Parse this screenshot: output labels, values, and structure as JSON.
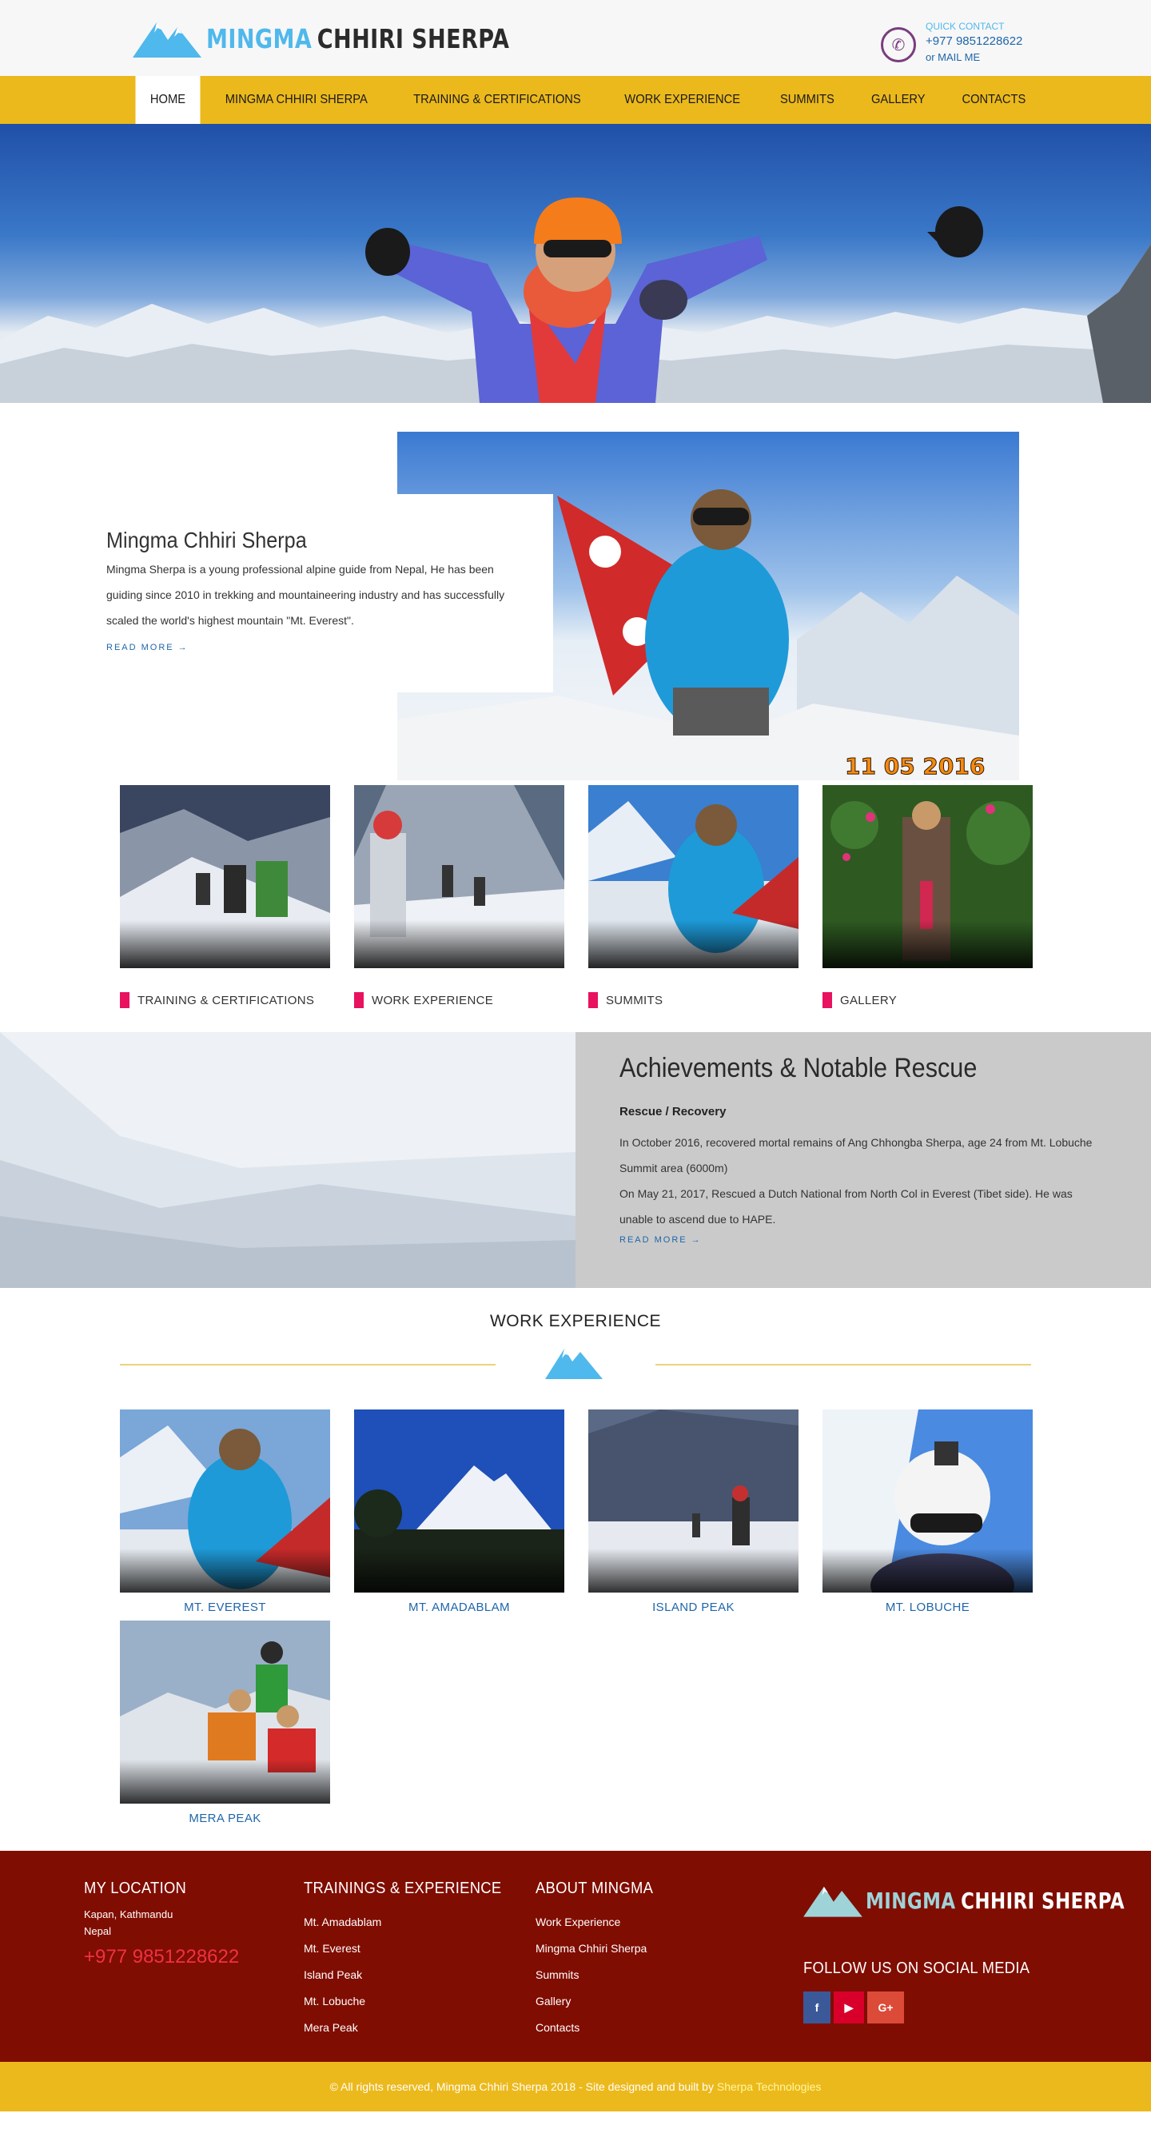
{
  "header": {
    "logo_part1": "MINGMA",
    "logo_part2": "CHHIRI SHERPA",
    "quick_contact_label": "QUICK CONTACT",
    "phone": "+977 9851228622",
    "mail_link": "or MAIL ME"
  },
  "nav": {
    "items": [
      "HOME",
      "MINGMA CHHIRI SHERPA",
      "TRAINING & CERTIFICATIONS",
      "WORK EXPERIENCE",
      "SUMMITS",
      "GALLERY",
      "CONTACTS"
    ],
    "active": "HOME"
  },
  "hero": {
    "photo_date_stamp": "11 05 2016"
  },
  "about": {
    "title": "Mingma Chhiri Sherpa",
    "text": "Mingma Sherpa is a young professional alpine guide from Nepal, He has been guiding since 2010 in trekking and mountaineering industry and has successfully scaled the world's highest mountain \"Mt. Everest\".",
    "read_more": "READ MORE →"
  },
  "cards": [
    {
      "label": "TRAINING & CERTIFICATIONS"
    },
    {
      "label": "WORK EXPERIENCE"
    },
    {
      "label": "SUMMITS"
    },
    {
      "label": "GALLERY"
    }
  ],
  "achievements": {
    "title": "Achievements & Notable Rescue",
    "subtitle": "Rescue / Recovery",
    "text1": "In October 2016, recovered mortal remains of Ang Chhongba Sherpa, age 24 from Mt. Lobuche Summit area (6000m)",
    "text2": "On May 21, 2017, Rescued a Dutch National from North Col in Everest (Tibet side). He was unable to ascend due to HAPE.",
    "read_more": "READ MORE →"
  },
  "work_experience": {
    "title": "WORK EXPERIENCE",
    "items": [
      {
        "caption": "MT. EVEREST"
      },
      {
        "caption": "MT. AMADABLAM"
      },
      {
        "caption": "ISLAND PEAK"
      },
      {
        "caption": "MT. LOBUCHE"
      },
      {
        "caption": "MERA PEAK"
      }
    ]
  },
  "footer": {
    "location_title": "MY LOCATION",
    "location_line1": "Kapan, Kathmandu",
    "location_line2": "Nepal",
    "phone": "+977 9851228622",
    "trainings_title": "TRAININGS & EXPERIENCE",
    "trainings_links": [
      "Mt. Amadablam",
      "Mt. Everest",
      "Island Peak",
      "Mt. Lobuche",
      "Mera Peak"
    ],
    "about_title": "ABOUT MINGMA",
    "about_links": [
      "Work Experience",
      "Mingma Chhiri Sherpa",
      "Summits",
      "Gallery",
      "Contacts"
    ],
    "social_title": "FOLLOW US ON SOCIAL MEDIA",
    "social": [
      {
        "icon": "facebook-icon",
        "glyph": "f"
      },
      {
        "icon": "youtube-icon",
        "glyph": "▶"
      },
      {
        "icon": "google-plus-icon",
        "glyph": "G+"
      }
    ]
  },
  "copyright": {
    "text": "© All rights reserved, Mingma Chhiri Sherpa 2018 - Site designed and built by ",
    "brand": "Sherpa Technologies"
  },
  "colors": {
    "nav_bg": "#ecb91c",
    "footer_bg": "#800d02",
    "accent_blue": "#1e66a9",
    "logo_blue": "#4fb8ec",
    "card_marker": "#e8125f"
  }
}
